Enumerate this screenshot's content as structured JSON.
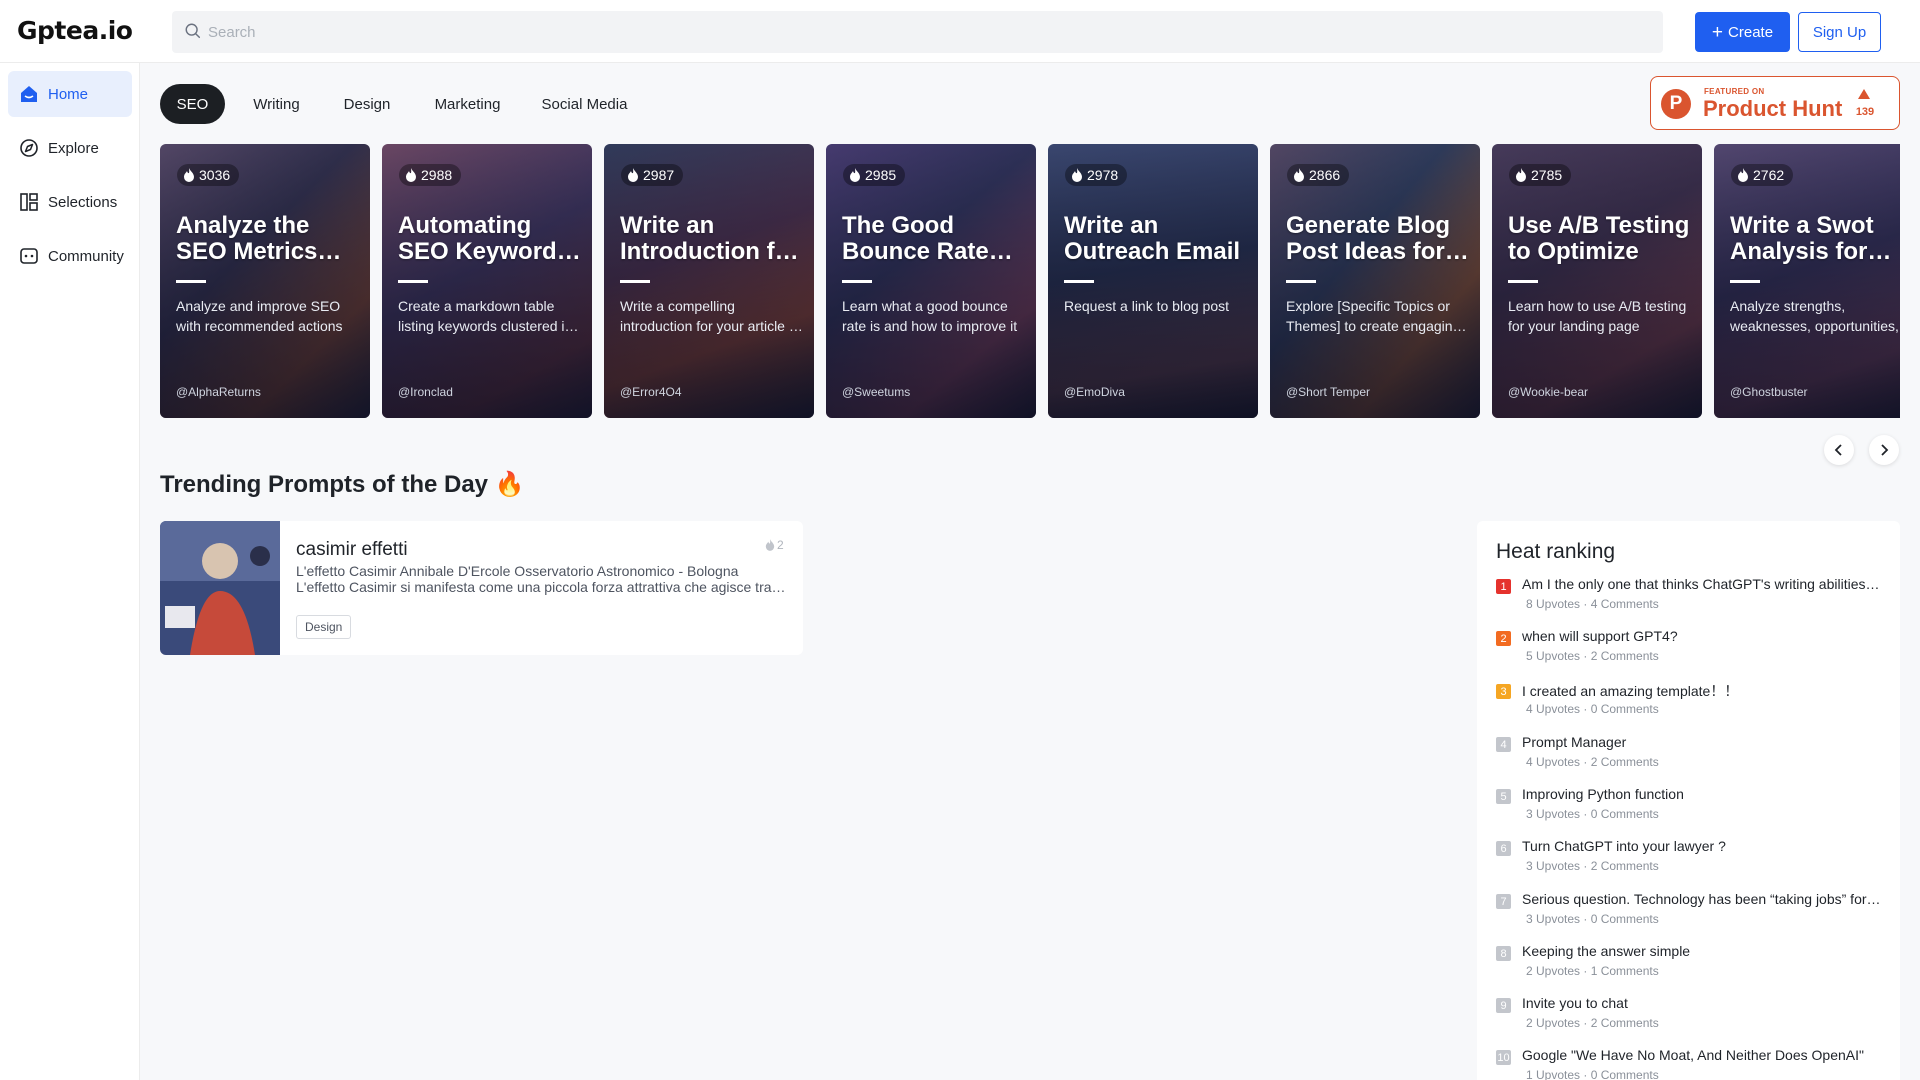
{
  "header": {
    "logo": "Gptea.io",
    "search_placeholder": "Search",
    "create_label": "Create",
    "signup_label": "Sign Up"
  },
  "sidebar": {
    "items": [
      {
        "label": "Home",
        "icon": "home-icon",
        "active": true
      },
      {
        "label": "Explore",
        "icon": "compass-icon",
        "active": false
      },
      {
        "label": "Selections",
        "icon": "selections-icon",
        "active": false
      },
      {
        "label": "Community",
        "icon": "community-icon",
        "active": false
      }
    ]
  },
  "tabs": [
    {
      "label": "SEO",
      "active": true
    },
    {
      "label": "Writing",
      "active": false
    },
    {
      "label": "Design",
      "active": false
    },
    {
      "label": "Marketing",
      "active": false
    },
    {
      "label": "Social Media",
      "active": false
    }
  ],
  "product_hunt": {
    "featured": "FEATURED ON",
    "name": "Product Hunt",
    "count": "139",
    "color": "#da552f"
  },
  "cards": [
    {
      "views": "3036",
      "title": "Analyze the SEO Metrics and Improve",
      "desc": "Analyze and improve SEO with recommended actions",
      "author": "@AlphaReturns"
    },
    {
      "views": "2988",
      "title": "Automating SEO Keyword Clustering",
      "desc": "Create a markdown table listing keywords clustered in groups",
      "author": "@Ironclad"
    },
    {
      "views": "2987",
      "title": "Write an Introduction for Your Article",
      "desc": "Write a compelling introduction for your article in seconds",
      "author": "@Error4O4"
    },
    {
      "views": "2985",
      "title": "The Good Bounce Rate Explained",
      "desc": "Learn what a good bounce rate is and how to improve it",
      "author": "@Sweetums"
    },
    {
      "views": "2978",
      "title": "Write an Outreach Email",
      "desc": "Request a link to blog post",
      "author": "@EmoDiva"
    },
    {
      "views": "2866",
      "title": "Generate Blog Post Ideas for Your Site",
      "desc": "Explore [Specific Topics or Themes] to create engaging content",
      "author": "@Short Temper"
    },
    {
      "views": "2785",
      "title": "Use A/B Testing to Optimize",
      "desc": "Learn how to use A/B testing for your landing page",
      "author": "@Wookie-bear"
    },
    {
      "views": "2762",
      "title": "Write a Swot Analysis for Business",
      "desc": "Analyze strengths, weaknesses, opportunities, threats",
      "author": "@Ghostbuster"
    }
  ],
  "trending": {
    "title": "Trending Prompts of the Day 🔥",
    "items": [
      {
        "title": "casimir effetti",
        "likes": "2",
        "desc": "L'effetto Casimir Annibale D'Ercole Osservatorio Astronomico - Bologna L'effetto Casimir si manifesta come una piccola forza attrattiva che agisce tra due lamelle metalliche",
        "tag": "Design"
      }
    ]
  },
  "ranking": {
    "title": "Heat ranking",
    "items": [
      {
        "num": "1",
        "title": "Am I the only one that thinks ChatGPT's writing abilities is overrated?",
        "meta": "8 Upvotes · 4 Comments",
        "color": "#e5322d"
      },
      {
        "num": "2",
        "title": "when will support GPT4?",
        "meta": "5 Upvotes · 2 Comments",
        "color": "#f26b21"
      },
      {
        "num": "3",
        "title": "I created an amazing template！！",
        "meta": "4 Upvotes · 0 Comments",
        "color": "#f5a623"
      },
      {
        "num": "4",
        "title": "Prompt Manager",
        "meta": "4 Upvotes · 2 Comments",
        "color": "#c3c6cc"
      },
      {
        "num": "5",
        "title": "Improving Python function",
        "meta": "3 Upvotes · 0 Comments",
        "color": "#c3c6cc"
      },
      {
        "num": "6",
        "title": "Turn ChatGPT into your lawyer ?",
        "meta": "3 Upvotes · 2 Comments",
        "color": "#c3c6cc"
      },
      {
        "num": "7",
        "title": "Serious question. Technology has been “taking jobs” for centuries",
        "meta": "3 Upvotes · 0 Comments",
        "color": "#c3c6cc"
      },
      {
        "num": "8",
        "title": "Keeping the answer simple",
        "meta": "2 Upvotes · 1 Comments",
        "color": "#c3c6cc"
      },
      {
        "num": "9",
        "title": "Invite you to chat",
        "meta": "2 Upvotes · 2 Comments",
        "color": "#c3c6cc"
      },
      {
        "num": "10",
        "title": "Google \"We Have No Moat, And Neither Does OpenAI\"",
        "meta": "1 Upvotes · 0 Comments",
        "color": "#c3c6cc"
      }
    ]
  }
}
